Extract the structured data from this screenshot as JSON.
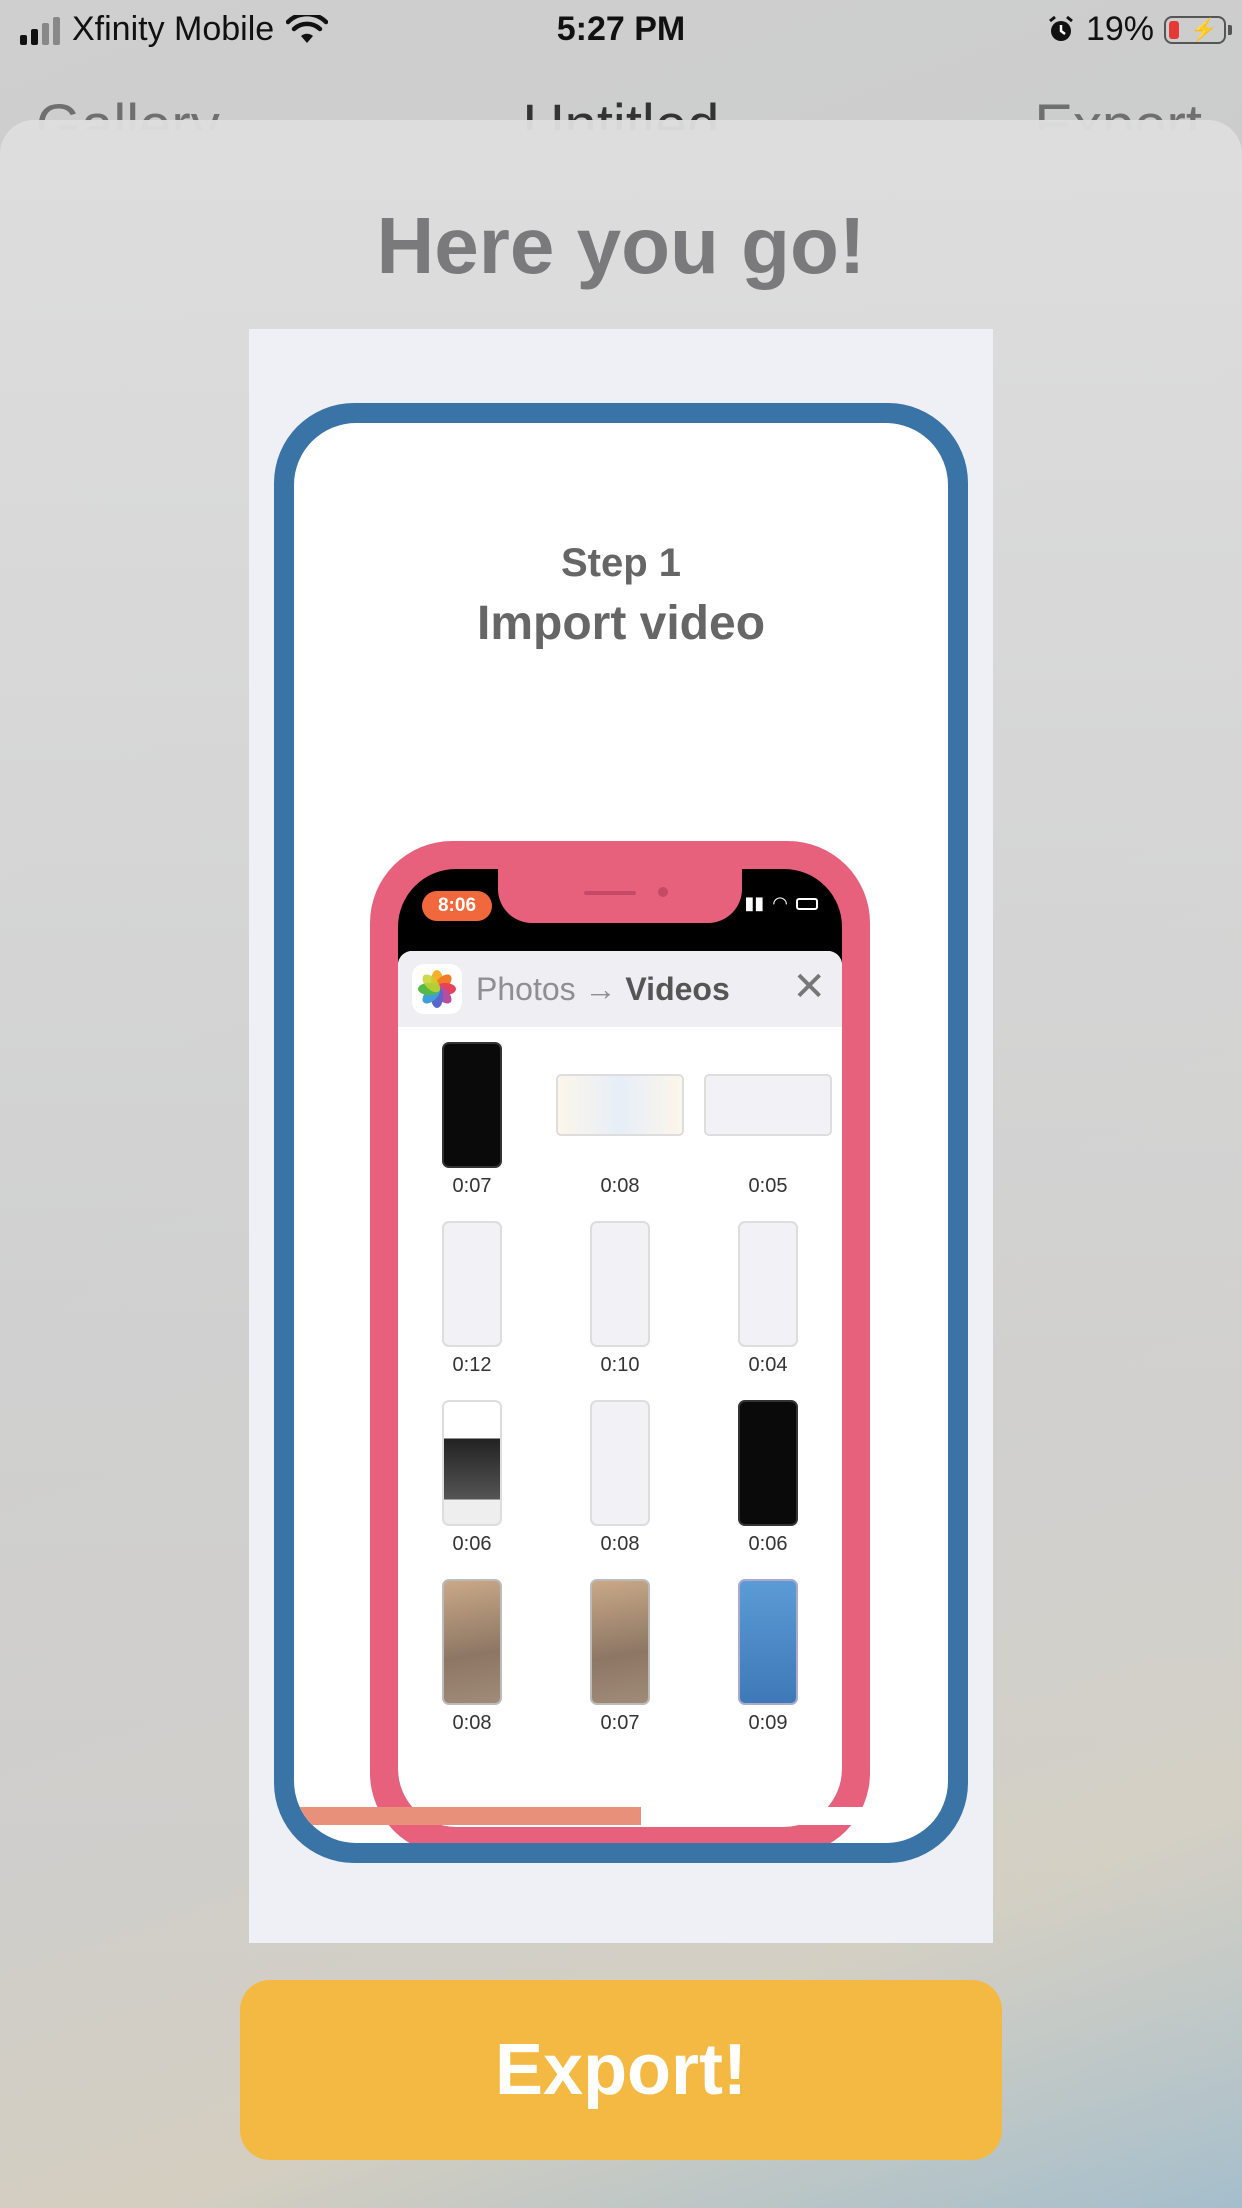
{
  "status_bar": {
    "carrier": "Xfinity Mobile",
    "time": "5:27 PM",
    "battery": "19%"
  },
  "background_nav": {
    "left": "Gallery",
    "title": "Untitled",
    "right": "Export"
  },
  "sheet": {
    "title": "Here you go!",
    "export_button": "Export!"
  },
  "preview": {
    "step_label": "Step 1",
    "step_title": "Import video",
    "progress": 0.53,
    "inner_phone": {
      "time": "8:06",
      "breadcrumb_source": "Photos",
      "breadcrumb_arrow": "→",
      "breadcrumb_target": "Videos",
      "videos": [
        {
          "duration": "0:07",
          "style": "t-port t-dark"
        },
        {
          "duration": "0:08",
          "style": "t-land t-pale"
        },
        {
          "duration": "0:05",
          "style": "t-land t-light"
        },
        {
          "duration": "0:12",
          "style": "t-port t-light"
        },
        {
          "duration": "0:10",
          "style": "t-port t-light"
        },
        {
          "duration": "0:04",
          "style": "t-port t-light"
        },
        {
          "duration": "0:06",
          "style": "t-port t-news"
        },
        {
          "duration": "0:08",
          "style": "t-port t-light"
        },
        {
          "duration": "0:06",
          "style": "t-port t-dark"
        },
        {
          "duration": "0:08",
          "style": "t-port t-photo"
        },
        {
          "duration": "0:07",
          "style": "t-port t-photo"
        },
        {
          "duration": "0:09",
          "style": "t-port t-sky"
        }
      ]
    }
  },
  "colors": {
    "accent": "#f4b942",
    "card_blue": "#3a73a6",
    "phone_pink": "#e7617d",
    "progress": "#e8907a"
  }
}
